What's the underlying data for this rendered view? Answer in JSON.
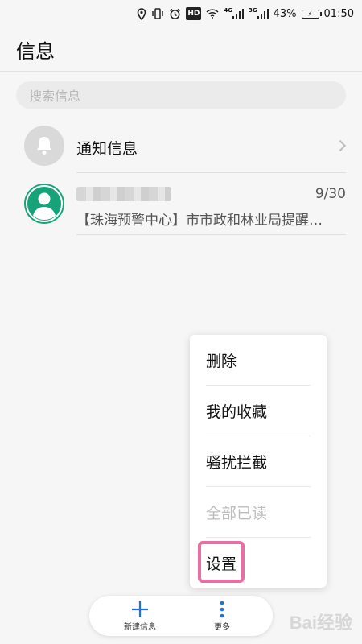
{
  "status_bar": {
    "hd": "HD",
    "network_4g": "4G",
    "network_3g": "3G",
    "battery": "43%",
    "time": "01:50"
  },
  "header": {
    "title": "信息"
  },
  "search": {
    "placeholder": "搜索信息"
  },
  "notification_row": {
    "title": "通知信息"
  },
  "message_row": {
    "date": "9/30",
    "preview": "【珠海预警中心】市市政和林业局提醒…"
  },
  "menu": {
    "items": [
      {
        "label": "删除",
        "enabled": true
      },
      {
        "label": "我的收藏",
        "enabled": true
      },
      {
        "label": "骚扰拦截",
        "enabled": true
      },
      {
        "label": "全部已读",
        "enabled": false
      },
      {
        "label": "设置",
        "enabled": true
      }
    ]
  },
  "bottom_bar": {
    "new_message_label": "新建信息",
    "more_label": "更多"
  },
  "watermark": "Bai经验",
  "colors": {
    "accent_blue": "#1f6fdc",
    "avatar_green": "#17a37a",
    "highlight_pink": "#e86fa4"
  }
}
